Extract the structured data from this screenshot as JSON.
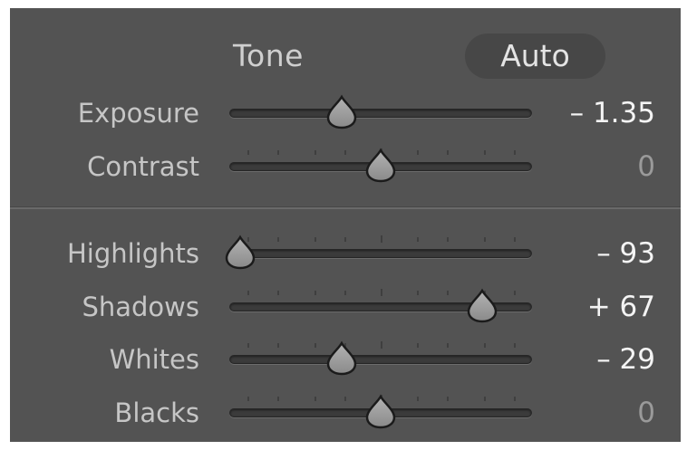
{
  "header": {
    "title": "Tone",
    "auto_label": "Auto"
  },
  "sliders_top": [
    {
      "label": "Exposure",
      "value_text": "– 1.35",
      "position": 0.37,
      "ticks": false,
      "neutral": false
    },
    {
      "label": "Contrast",
      "value_text": "0",
      "position": 0.5,
      "ticks": true,
      "neutral": true
    }
  ],
  "sliders_bottom": [
    {
      "label": "Highlights",
      "value_text": "– 93",
      "position": 0.035,
      "ticks": true,
      "neutral": false
    },
    {
      "label": "Shadows",
      "value_text": "+ 67",
      "position": 0.835,
      "ticks": true,
      "neutral": false
    },
    {
      "label": "Whites",
      "value_text": "– 29",
      "position": 0.37,
      "ticks": true,
      "neutral": false
    },
    {
      "label": "Blacks",
      "value_text": "0",
      "position": 0.5,
      "ticks": true,
      "neutral": true
    }
  ],
  "colors": {
    "panel_background": "#535353",
    "auto_button_background": "#474747",
    "label_text": "#c6c6c6",
    "value_text": "#f4f4f4",
    "zero_value_text": "#9a9a9a",
    "thumb_fill": "#9b9b9b"
  },
  "icons": {
    "slider_thumb": "teardrop-thumb-icon"
  }
}
